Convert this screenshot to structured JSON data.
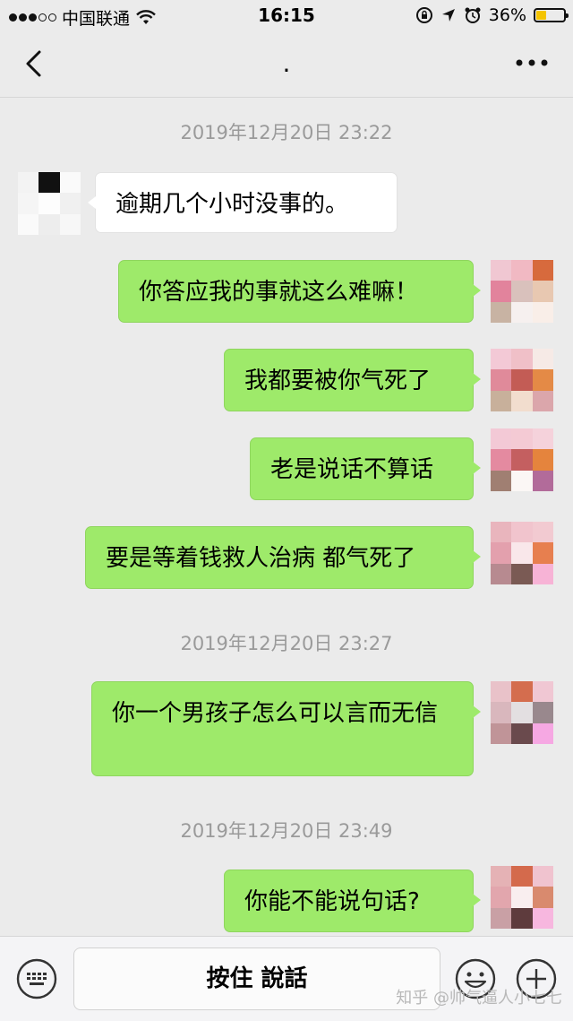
{
  "status_bar": {
    "carrier": "中国联通",
    "time": "16:15",
    "battery": "36%",
    "battery_level": 0.36,
    "icons": [
      "signal-dots-icon",
      "wifi-icon",
      "rotation-lock-icon",
      "location-icon",
      "alarm-icon",
      "battery-icon"
    ]
  },
  "nav": {
    "title": ".",
    "back_icon": "chevron-left-icon",
    "more_icon": "more-dots-icon"
  },
  "messages": [
    {
      "type": "timestamp",
      "text": "2019年12月20日 23:22"
    },
    {
      "type": "in",
      "text": "逾期几个小时没事的。"
    },
    {
      "type": "out",
      "text": "你答应我的事就这么难嘛！"
    },
    {
      "type": "out",
      "text": "我都要被你气死了"
    },
    {
      "type": "out",
      "text": "老是说话不算话"
    },
    {
      "type": "out",
      "text": "要是等着钱救人治病 都气死了"
    },
    {
      "type": "timestamp",
      "text": "2019年12月20日 23:27"
    },
    {
      "type": "out",
      "text": "你一个男孩子怎么可以言而无信"
    },
    {
      "type": "timestamp",
      "text": "2019年12月20日 23:49"
    },
    {
      "type": "out",
      "text": "你能不能说句话?"
    }
  ],
  "input_bar": {
    "hold_to_talk": "按住 說話",
    "keyboard_icon": "keyboard-icon",
    "emoji_icon": "emoji-icon",
    "plus_icon": "plus-circle-icon"
  },
  "watermark": "知乎 @帅气逼人小七七",
  "colors": {
    "background": "#ebebeb",
    "outgoing_bubble": "#9eea6a",
    "incoming_bubble": "#ffffff",
    "timestamp_text": "#9a9a9a"
  }
}
